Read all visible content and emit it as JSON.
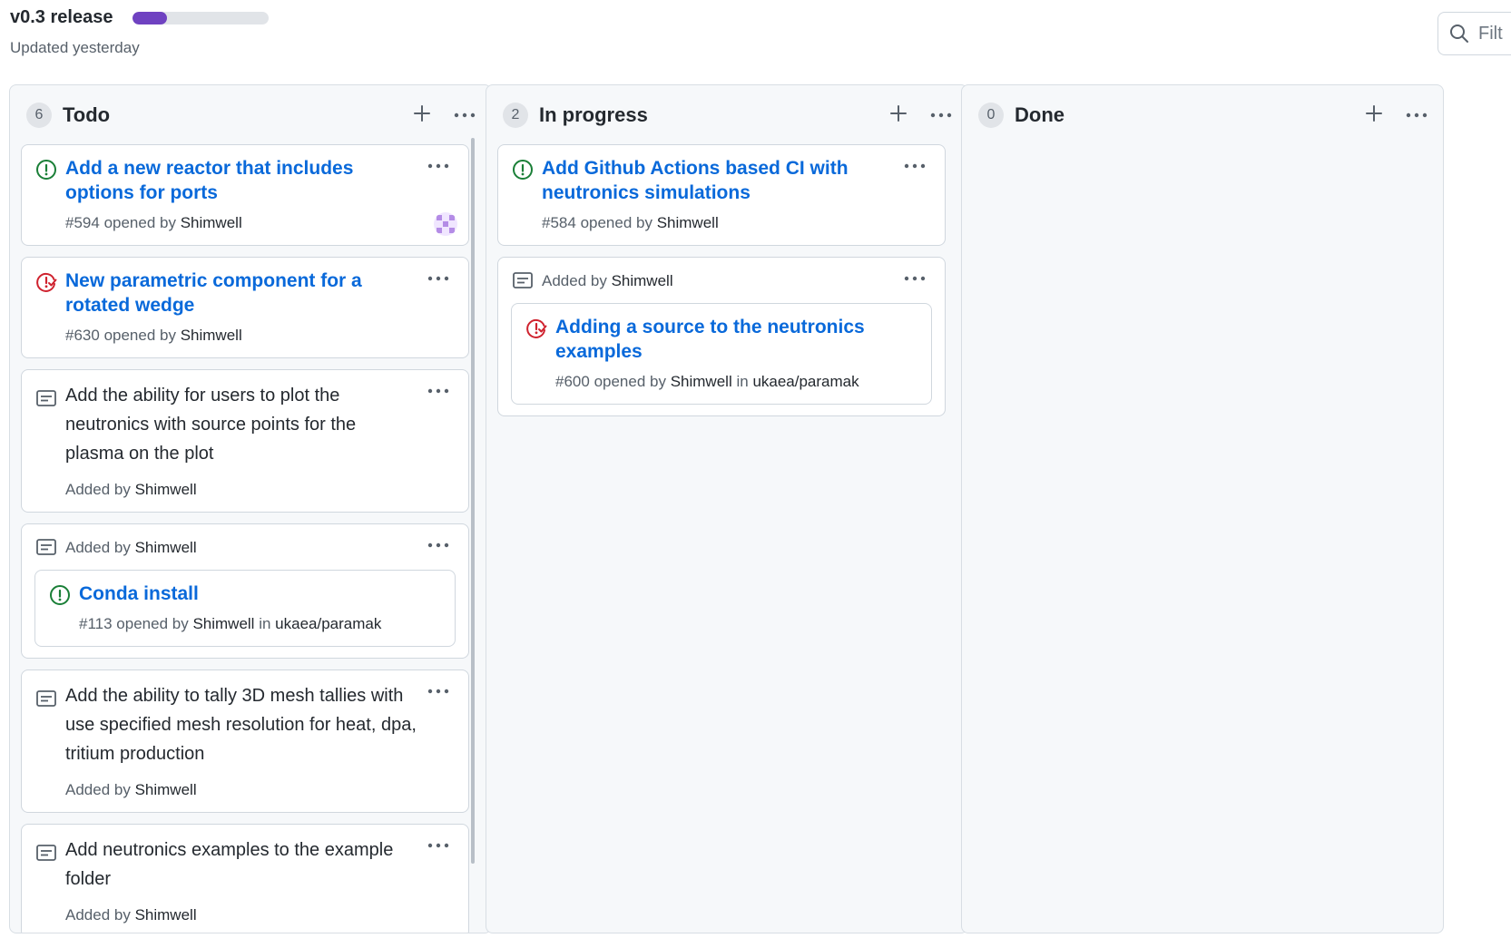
{
  "project": {
    "title": "v0.3 release",
    "progress_fraction": 0.25,
    "updated": "Updated yesterday",
    "progress_color": "#6f42c1"
  },
  "filter": {
    "placeholder": "Filt"
  },
  "columns": [
    {
      "name": "Todo",
      "count": "6",
      "cards": [
        {
          "type": "issue",
          "state": "open",
          "title": "Add a new reactor that includes options for ports",
          "number": "#594",
          "opened_by": "opened by",
          "author": "Shimwell",
          "has_avatar": true
        },
        {
          "type": "issue",
          "state": "closed",
          "title": "New parametric component for a rotated wedge",
          "number": "#630",
          "opened_by": "opened by",
          "author": "Shimwell"
        },
        {
          "type": "note",
          "text": "Add the ability for users to plot the neutronics with source points for the plasma on the plot",
          "added_by": "Added by",
          "author": "Shimwell"
        },
        {
          "type": "linked",
          "added_by": "Added by",
          "author": "Shimwell",
          "issue": {
            "state": "open",
            "title": "Conda install",
            "number": "#113",
            "opened_by": "opened by",
            "author": "Shimwell",
            "in": "in",
            "repo": "ukaea/paramak"
          }
        },
        {
          "type": "note",
          "text": "Add the ability to tally 3D mesh tallies with use specified mesh resolution for heat, dpa, tritium production",
          "added_by": "Added by",
          "author": "Shimwell"
        },
        {
          "type": "note",
          "text": "Add neutronics examples to the example folder",
          "added_by": "Added by",
          "author": "Shimwell"
        }
      ]
    },
    {
      "name": "In progress",
      "count": "2",
      "cards": [
        {
          "type": "issue",
          "state": "open",
          "title": "Add Github Actions based CI with neutronics simulations",
          "number": "#584",
          "opened_by": "opened by",
          "author": "Shimwell"
        },
        {
          "type": "linked",
          "added_by": "Added by",
          "author": "Shimwell",
          "issue": {
            "state": "closed",
            "title": "Adding a source to the neutronics examples",
            "number": "#600",
            "opened_by": "opened by",
            "author": "Shimwell",
            "in": "in",
            "repo": "ukaea/paramak"
          }
        }
      ]
    },
    {
      "name": "Done",
      "count": "0",
      "cards": []
    }
  ],
  "colors": {
    "open": "#1a7f37",
    "closed": "#cf222e",
    "link": "#0969da"
  },
  "icons": {
    "open_issue": "issue-opened-icon",
    "closed_issue": "issue-closed-icon",
    "note": "note-icon",
    "add": "plus-icon",
    "menu": "kebab-horizontal-icon",
    "search": "search-icon"
  }
}
